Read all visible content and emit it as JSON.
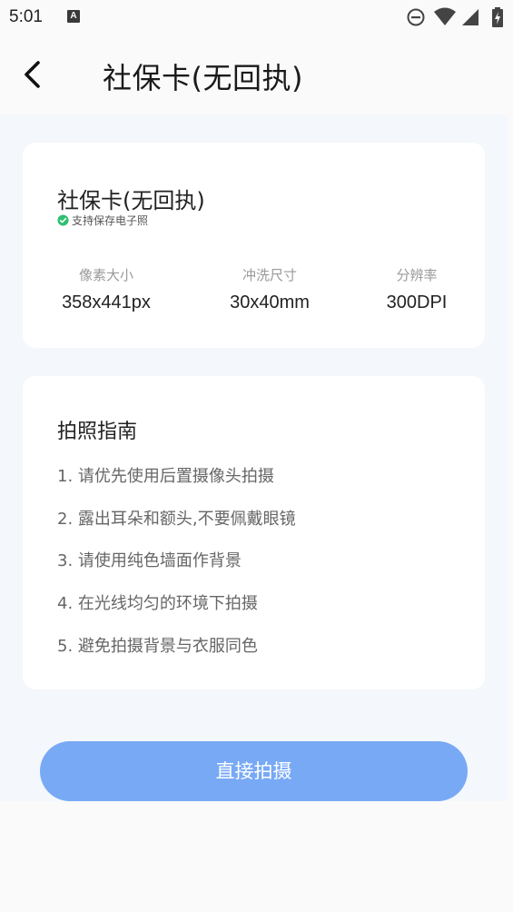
{
  "status_bar": {
    "time": "5:01",
    "notification_glyph": "A",
    "icons": [
      "a-notification-icon",
      "dnd-icon",
      "wifi-icon",
      "cellular-signal-icon",
      "battery-charging-icon"
    ]
  },
  "header": {
    "title": "社保卡(无回执)",
    "back_icon": "chevron-left-icon"
  },
  "spec_card": {
    "name": "社保卡(无回执)",
    "save_note": "支持保存电子照",
    "save_note_icon": "check-circle-icon",
    "save_note_icon_color": "#2fbf71",
    "specs": [
      {
        "label": "像素大小",
        "value": "358x441px"
      },
      {
        "label": "冲洗尺寸",
        "value": "30x40mm"
      },
      {
        "label": "分辨率",
        "value": "300DPI"
      }
    ]
  },
  "guide_card": {
    "title": "拍照指南",
    "items": [
      "1. 请优先使用后置摄像头拍摄",
      "2. 露出耳朵和额头,不要佩戴眼镜",
      "3. 请使用纯色墙面作背景",
      "4. 在光线均匀的环境下拍摄",
      "5. 避免拍摄背景与衣服同色"
    ]
  },
  "action": {
    "shoot_label": "直接拍摄",
    "button_color": "#78a9f5"
  }
}
